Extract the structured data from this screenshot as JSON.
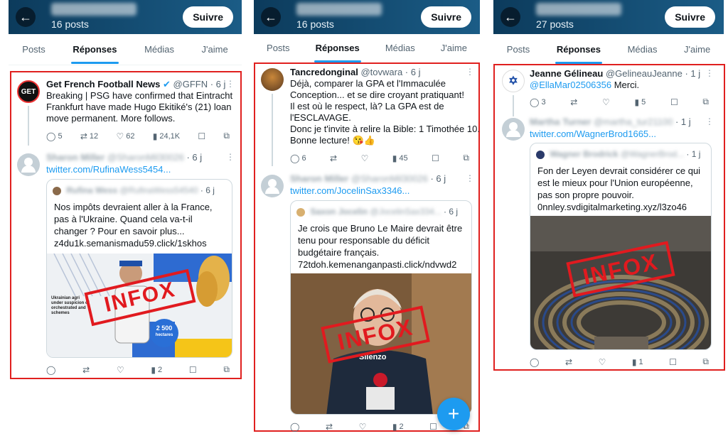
{
  "panels": [
    {
      "header": {
        "posts": "16 posts",
        "follow": "Suivre"
      },
      "tabs": [
        "Posts",
        "Réponses",
        "Médias",
        "J'aime"
      ],
      "tweet1": {
        "avatar": "GET",
        "name": "Get French Football News",
        "handle": "@GFFN · 6 j",
        "text": [
          "Breaking | PSG have confirmed that Eintracht",
          "Frankfurt have made Hugo Ekitiké's (21) loan",
          "move permanent. More follows."
        ],
        "stats": {
          "replies": "5",
          "retweets": "12",
          "likes": "62",
          "views": "24,1K"
        }
      },
      "reply": {
        "name": "Sharon Miller",
        "handle": "@SharonMil30026",
        "time": "· 6 j",
        "link": "twitter.com/RufinaWess5454..."
      },
      "quote": {
        "name": "Rufina Wess",
        "handle": "@RufinaWess54540",
        "time": "· 6 j",
        "text": [
          "Nos impôts devraient aller à la France,",
          "pas à l'Ukraine. Quand cela va-t-il",
          "changer ? Pour en savoir plus...",
          "z4du1k.semanismadu59.click/1skhos"
        ],
        "img_text": [
          "Ukrainian agri",
          "under suspicion of",
          "orchestrated and",
          "schemes"
        ],
        "badge": "2 500",
        "badge_sub": "hectares"
      },
      "stamp": "INFOX",
      "reply_stats": {
        "views": "2"
      }
    },
    {
      "header": {
        "posts": "16 posts",
        "follow": "Suivre"
      },
      "tabs": [
        "Posts",
        "Réponses",
        "Médias",
        "J'aime"
      ],
      "tweet1": {
        "name": "Tancredonginal",
        "handle": "@tovwara · 6 j",
        "text": [
          "Déjà, comparer la GPA et l'Immaculée",
          "Conception... et se dire croyant pratiquant!",
          "Il est où le respect, là? La GPA est de",
          "l'ESCLAVAGE.",
          "Donc je t'invite à relire la Bible: 1 Timothée 10.",
          "Bonne lecture! 😘👍"
        ],
        "stats": {
          "replies": "6",
          "views": "45"
        }
      },
      "reply": {
        "name": "Sharon Miller",
        "handle": "@SharonMil30026",
        "time": "· 6 j",
        "link": "twitter.com/JocelinSax3346..."
      },
      "quote": {
        "name": "Saxon Jocelin",
        "handle": "@JocelinSax334...",
        "time": "· 6 j",
        "text": [
          "Je crois que Bruno Le Maire devrait être",
          "tenu pour responsable du déficit",
          "budgétaire français.",
          "72tdoh.kemenanganpasti.click/ndvwd2"
        ],
        "shirt": "Silenzo"
      },
      "stamp": "INFOX",
      "reply_stats": {
        "views": "2"
      },
      "fab": "+"
    },
    {
      "header": {
        "posts": "27 posts",
        "follow": "Suivre"
      },
      "tabs": [
        "Posts",
        "Réponses",
        "Médias",
        "J'aime"
      ],
      "tweet1": {
        "name": "Jeanne Gélineau",
        "handle": "@GelineauJeanne · 1 j",
        "mention": "@EllaMar02506356",
        "text_rest": " Merci.",
        "stats": {
          "replies": "3",
          "views": "5"
        }
      },
      "reply": {
        "name": "Martha Turner",
        "handle": "@martha_tur21100",
        "time": "· 1 j",
        "link": "twitter.com/WagnerBrod1665..."
      },
      "quote": {
        "name": "Wagner Brodrick",
        "handle": "@WagnerBrod...",
        "time": "· 1 j",
        "text": [
          "Fon der Leyen devrait considérer ce qui",
          "est le mieux pour l'Union européenne,",
          "pas son propre pouvoir.",
          "0nnley.svdigitalmarketing.xyz/l3zo46"
        ]
      },
      "stamp": "INFOX",
      "reply_stats": {
        "views": "1"
      }
    }
  ],
  "colors": {
    "accent": "#1d9bf0",
    "frame": "#e0201f",
    "header": "#0c3b5c"
  }
}
